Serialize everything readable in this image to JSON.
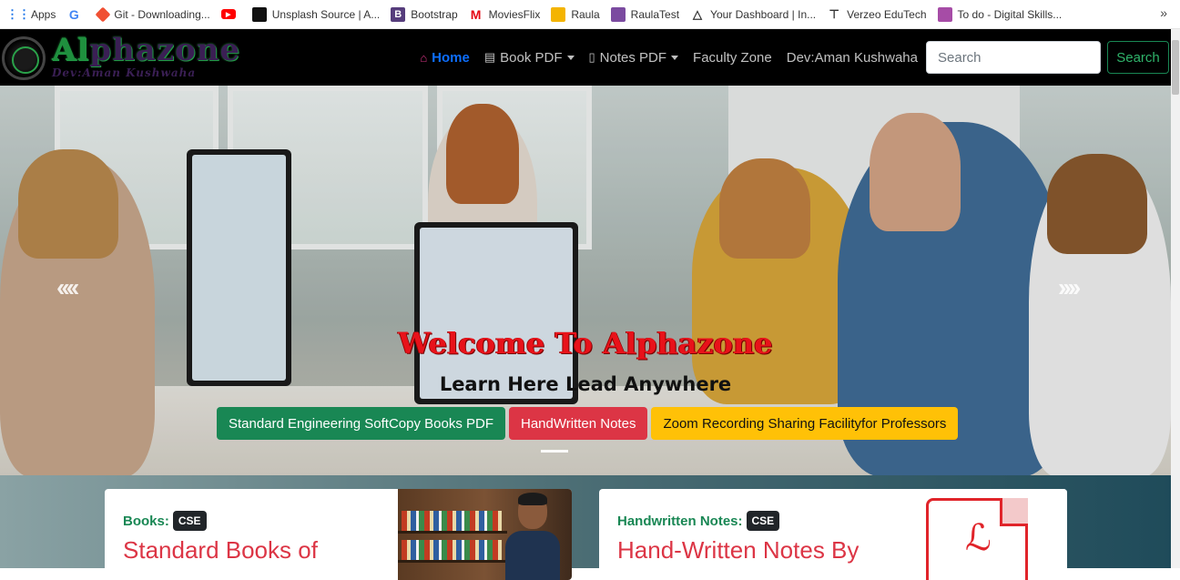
{
  "bookmarks": [
    {
      "label": "Apps",
      "icon": "apps-grid-icon",
      "color": "#1a73e8"
    },
    {
      "label": "",
      "icon": "google-icon",
      "color": "#4285f4"
    },
    {
      "label": "Git - Downloading...",
      "icon": "git-icon",
      "color": "#f05033"
    },
    {
      "label": "",
      "icon": "youtube-icon",
      "color": "#ff0000"
    },
    {
      "label": "Unsplash Source | A...",
      "icon": "unsplash-icon",
      "color": "#111111"
    },
    {
      "label": "Bootstrap",
      "icon": "bootstrap-icon",
      "color": "#563d7c"
    },
    {
      "label": "MoviesFlix",
      "icon": "moviesflix-icon",
      "color": "#e50914"
    },
    {
      "label": "Raula",
      "icon": "raula-icon",
      "color": "#f4b400"
    },
    {
      "label": "RaulaTest",
      "icon": "raulatest-icon",
      "color": "#7b4ba0"
    },
    {
      "label": "Your Dashboard | In...",
      "icon": "dashboard-icon",
      "color": "#333333"
    },
    {
      "label": "Verzeo EduTech",
      "icon": "verzeo-icon",
      "color": "#333333"
    },
    {
      "label": "To do - Digital Skills...",
      "icon": "todo-icon",
      "color": "#a64ca6"
    }
  ],
  "bookmarks_more": "»",
  "brand": {
    "title_part1": "Al",
    "title_part2": "phazone",
    "subtitle": "Dev:Aman Kushwaha"
  },
  "nav": {
    "home": "Home",
    "book_pdf": "Book PDF",
    "notes_pdf": "Notes PDF",
    "faculty_zone": "Faculty Zone",
    "dev": "Dev:Aman Kushwaha",
    "search_placeholder": "Search",
    "search_button": "Search"
  },
  "hero": {
    "title": "Welcome To Alphazone",
    "subtitle": "Learn Here Lead Anywhere",
    "prev": "‹‹‹‹",
    "next": "››››",
    "buttons": {
      "books": "Standard Engineering SoftCopy Books PDF",
      "notes": "HandWritten Notes",
      "zoom": "Zoom Recording Sharing Facilityfor Professors"
    }
  },
  "cards": [
    {
      "label": "Books:",
      "badge": "CSE",
      "title": "Standard Books of"
    },
    {
      "label": "Handwritten Notes:",
      "badge": "CSE",
      "title": "Hand-Written Notes By"
    }
  ],
  "colors": {
    "navbar_bg": "#000000",
    "accent_green": "#198754",
    "accent_red": "#dc3545",
    "accent_yellow": "#ffc107",
    "hero_title": "#e8121a"
  }
}
